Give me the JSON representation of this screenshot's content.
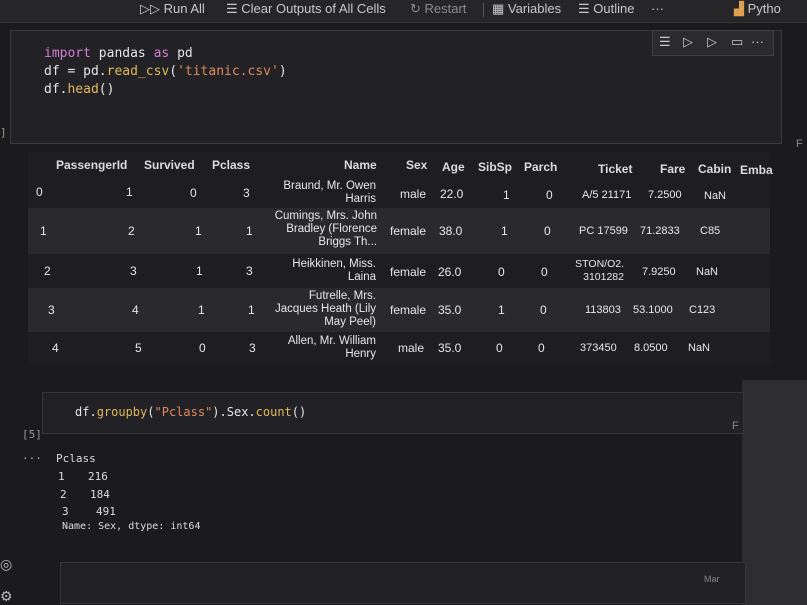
{
  "toolbar": {
    "run_all": "Run All",
    "clear_outputs": "Clear Outputs of All Cells",
    "restart": "Restart",
    "variables": "Variables",
    "outline": "Outline",
    "more": "···",
    "kernel": "Pytho"
  },
  "cell1": {
    "exec": "]",
    "lines": [
      {
        "kw": "import",
        "rest1": " pandas ",
        "kw2": "as",
        "rest2": " pd"
      },
      {
        "pre": "df = pd.",
        "fn": "read_csv",
        "open": "(",
        "str": "'titanic.csv'",
        "close": ")"
      },
      {
        "pre": "df.",
        "fn": "head",
        "post": "()"
      }
    ]
  },
  "dataframe": {
    "columns": [
      "PassengerId",
      "Survived",
      "Pclass",
      "Name",
      "Sex",
      "Age",
      "SibSp",
      "Parch",
      "Ticket",
      "Fare",
      "Cabin",
      "Emba"
    ],
    "rows": [
      {
        "index": "0",
        "PassengerId": "1",
        "Survived": "0",
        "Pclass": "3",
        "Name": "Braund, Mr. Owen Harris",
        "Sex": "male",
        "Age": "22.0",
        "SibSp": "1",
        "Parch": "0",
        "Ticket": "A/5 21171",
        "Fare": "7.2500",
        "Cabin": "NaN"
      },
      {
        "index": "1",
        "PassengerId": "2",
        "Survived": "1",
        "Pclass": "1",
        "Name": "Cumings, Mrs. John Bradley (Florence Briggs Th...",
        "Sex": "female",
        "Age": "38.0",
        "SibSp": "1",
        "Parch": "0",
        "Ticket": "PC 17599",
        "Fare": "71.2833",
        "Cabin": "C85"
      },
      {
        "index": "2",
        "PassengerId": "3",
        "Survived": "1",
        "Pclass": "3",
        "Name": "Heikkinen, Miss. Laina",
        "Sex": "female",
        "Age": "26.0",
        "SibSp": "0",
        "Parch": "0",
        "Ticket": "STON/O2. 3101282",
        "Fare": "7.9250",
        "Cabin": "NaN"
      },
      {
        "index": "3",
        "PassengerId": "4",
        "Survived": "1",
        "Pclass": "1",
        "Name": "Futrelle, Mrs. Jacques Heath (Lily May Peel)",
        "Sex": "female",
        "Age": "35.0",
        "SibSp": "1",
        "Parch": "0",
        "Ticket": "113803",
        "Fare": "53.1000",
        "Cabin": "C123"
      },
      {
        "index": "4",
        "PassengerId": "5",
        "Survived": "0",
        "Pclass": "3",
        "Name": "Allen, Mr. William Henry",
        "Sex": "male",
        "Age": "35.0",
        "SibSp": "0",
        "Parch": "0",
        "Ticket": "373450",
        "Fare": "8.0500",
        "Cabin": "NaN"
      }
    ]
  },
  "cell2": {
    "exec": "[5]",
    "code_pre": "df.",
    "code_fn": "groupby",
    "code_open": "(",
    "code_str": "\"Pclass\"",
    "code_mid": ").Sex.",
    "code_fn2": "count",
    "code_post": "()",
    "output_marker": "···",
    "output": {
      "header": "Pclass",
      "rows": [
        [
          "1",
          "216"
        ],
        [
          "2",
          "184"
        ],
        [
          "3",
          "491"
        ]
      ],
      "footer": "Name: Sex, dtype: int64"
    }
  },
  "side": {
    "marker1": "F",
    "marker2": "F",
    "mar": "Mar"
  }
}
